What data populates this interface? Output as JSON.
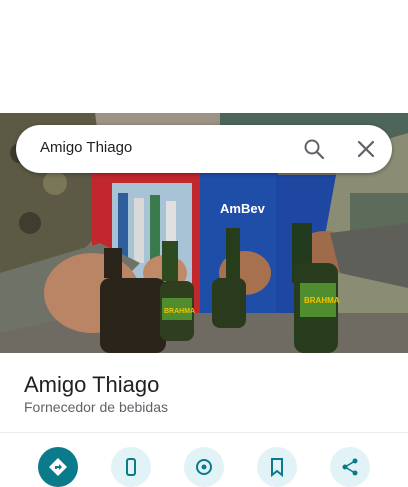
{
  "search": {
    "query": "Amigo Thiago"
  },
  "place": {
    "name": "Amigo Thiago",
    "category": "Fornecedor de bebidas"
  },
  "photo": {
    "crate_brand": "AmBev",
    "bottle_brand": "BRAHMA"
  },
  "icons": {
    "search": "search-icon",
    "close": "close-icon",
    "actions": [
      "directions-icon",
      "phone-icon",
      "website-icon",
      "save-icon",
      "share-icon"
    ]
  },
  "colors": {
    "primary_action": "#0b7a8a",
    "secondary_action": "#e1f3f6"
  }
}
